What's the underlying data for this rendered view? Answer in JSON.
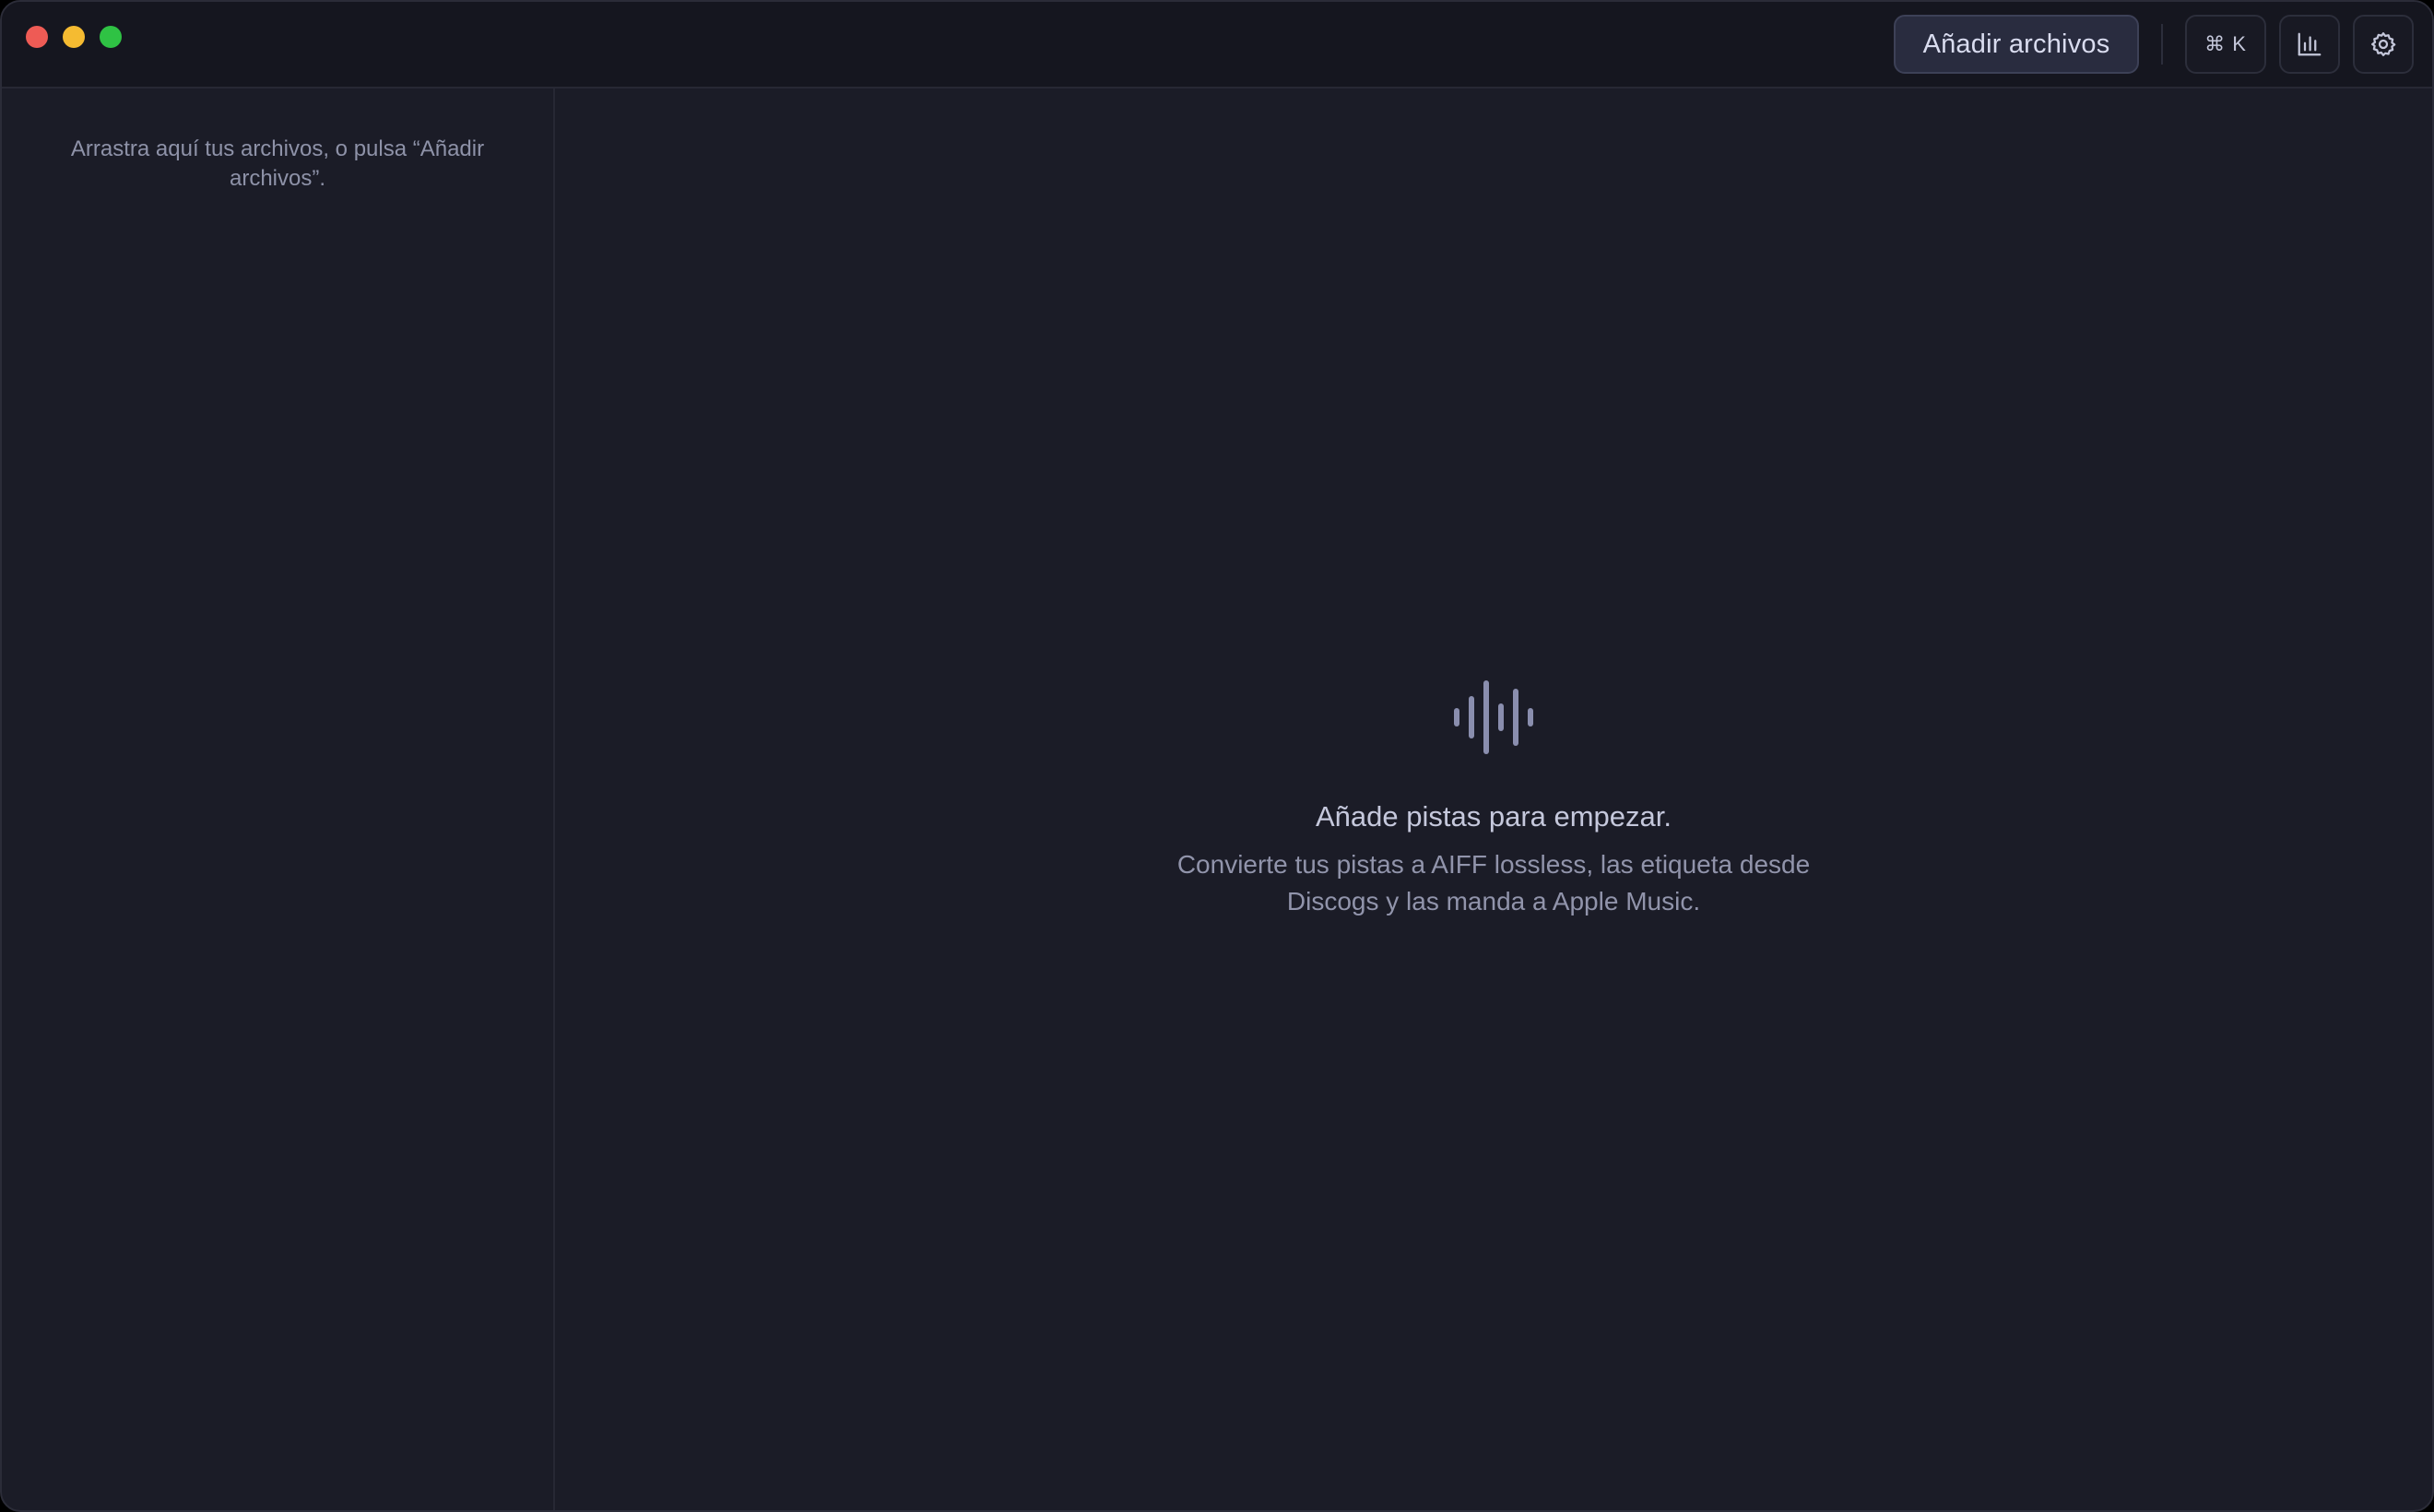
{
  "titlebar": {
    "add_files_label": "Añadir archivos",
    "shortcut_label": "⌘ K",
    "icons": {
      "stats": "bar-chart-icon",
      "settings": "gear-icon"
    }
  },
  "sidebar": {
    "hint": "Arrastra aquí tus archivos, o pulsa “Añadir archivos”."
  },
  "main": {
    "empty_icon": "audio-waveform-icon",
    "empty_title": "Añade pistas para empezar.",
    "empty_description": "Convierte tus pistas a AIFF lossless, las etiqueta desde Discogs y las manda a Apple Music."
  },
  "colors": {
    "window_bg": "#1b1c27",
    "titlebar_bg": "#15161f",
    "accent_button": "#292c3f",
    "close": "#ee5b55",
    "minimize": "#f5bb31",
    "zoom": "#2fc244"
  }
}
